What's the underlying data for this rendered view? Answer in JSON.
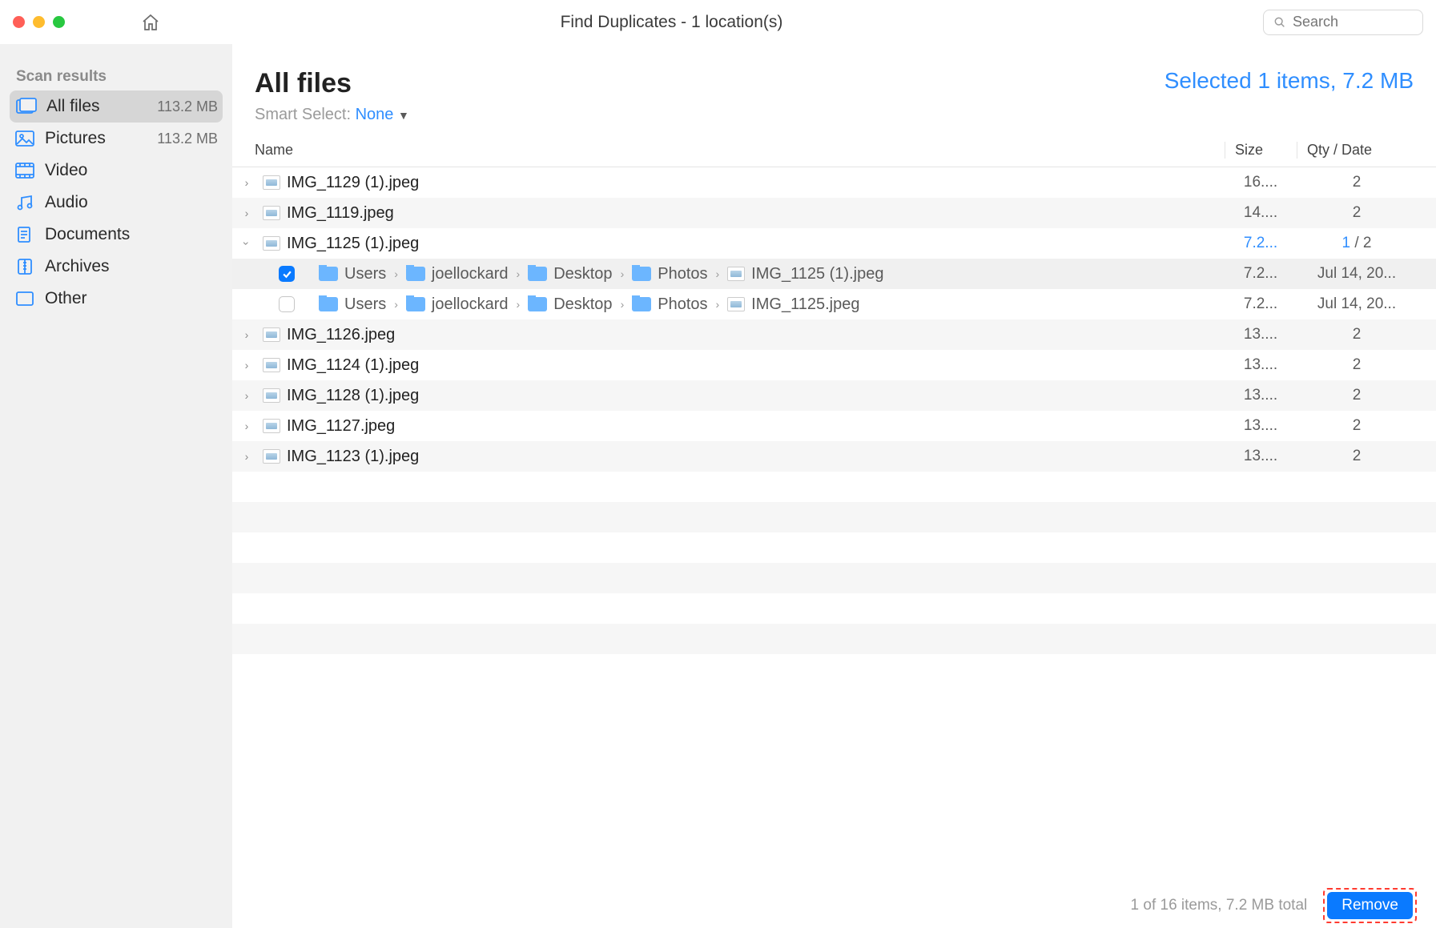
{
  "window": {
    "title": "Find Duplicates - 1 location(s)",
    "search_placeholder": "Search"
  },
  "sidebar": {
    "heading": "Scan results",
    "items": [
      {
        "label": "All files",
        "size": "113.2 MB",
        "active": true
      },
      {
        "label": "Pictures",
        "size": "113.2 MB"
      },
      {
        "label": "Video",
        "size": ""
      },
      {
        "label": "Audio",
        "size": ""
      },
      {
        "label": "Documents",
        "size": ""
      },
      {
        "label": "Archives",
        "size": ""
      },
      {
        "label": "Other",
        "size": ""
      }
    ]
  },
  "header": {
    "page_title": "All files",
    "selection_status": "Selected 1 items, 7.2 MB",
    "smart_select_label": "Smart Select:",
    "smart_select_value": "None"
  },
  "columns": {
    "name": "Name",
    "size": "Size",
    "qty": "Qty / Date"
  },
  "rows": [
    {
      "name": "IMG_1129 (1).jpeg",
      "size": "16....",
      "qty": "2"
    },
    {
      "name": "IMG_1119.jpeg",
      "size": "14....",
      "qty": "2"
    },
    {
      "name": "IMG_1125 (1).jpeg",
      "size": "7.2...",
      "qty_sel": "1",
      "qty_total": " / 2",
      "expanded": true,
      "children": [
        {
          "checked": true,
          "path": [
            "Users",
            "joellockard",
            "Desktop",
            "Photos"
          ],
          "file": "IMG_1125 (1).jpeg",
          "size": "7.2...",
          "date": "Jul 14, 20..."
        },
        {
          "checked": false,
          "path": [
            "Users",
            "joellockard",
            "Desktop",
            "Photos"
          ],
          "file": "IMG_1125.jpeg",
          "size": "7.2...",
          "date": "Jul 14, 20..."
        }
      ]
    },
    {
      "name": "IMG_1126.jpeg",
      "size": "13....",
      "qty": "2"
    },
    {
      "name": "IMG_1124 (1).jpeg",
      "size": "13....",
      "qty": "2"
    },
    {
      "name": "IMG_1128 (1).jpeg",
      "size": "13....",
      "qty": "2"
    },
    {
      "name": "IMG_1127.jpeg",
      "size": "13....",
      "qty": "2"
    },
    {
      "name": "IMG_1123 (1).jpeg",
      "size": "13....",
      "qty": "2"
    }
  ],
  "footer": {
    "status": "1 of 16 items, 7.2 MB total",
    "remove_label": "Remove"
  }
}
